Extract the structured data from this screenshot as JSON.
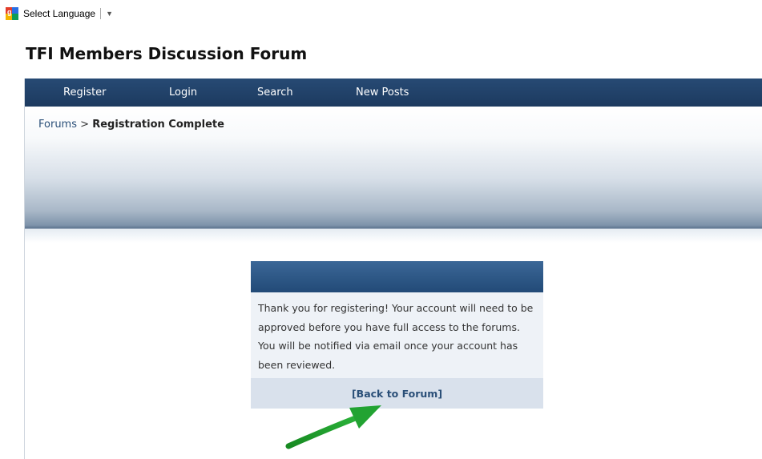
{
  "translate_widget": {
    "label": "Select Language",
    "icon": "google-translate-icon",
    "caret": "▼"
  },
  "forum": {
    "title": "TFI Members Discussion Forum"
  },
  "navbar": {
    "items": [
      {
        "label": "Register"
      },
      {
        "label": "Login"
      },
      {
        "label": "Search"
      },
      {
        "label": "New Posts"
      }
    ]
  },
  "breadcrumb": {
    "root": "Forums",
    "separator": ">",
    "current": "Registration Complete"
  },
  "message": {
    "body": "Thank you for registering! Your account will need to be approved before you have full access to the forums. You will be notified via email once your account has been reviewed.",
    "back_link": "[Back to Forum]"
  },
  "colors": {
    "navbar": "#1f4168",
    "link": "#2a4f78",
    "annotation_arrow": "#1e9a2a"
  }
}
